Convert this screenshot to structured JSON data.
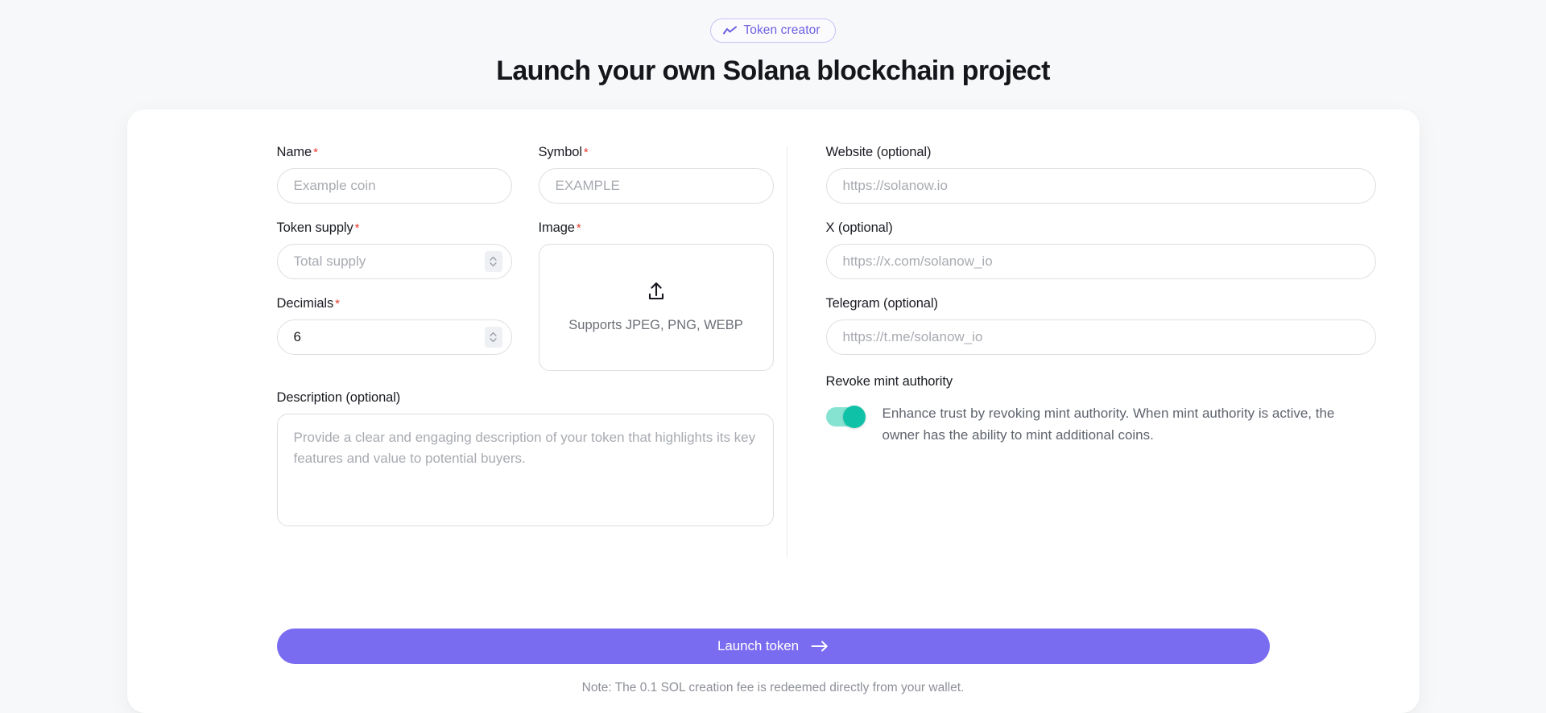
{
  "header": {
    "badge_label": "Token creator",
    "badge_icon": "trending-line-icon",
    "badge_color": "#6c5fe0",
    "headline": "Launch your own Solana blockchain project"
  },
  "form": {
    "name": {
      "label": "Name",
      "required_mark": "*",
      "placeholder": "Example coin",
      "value": ""
    },
    "symbol": {
      "label": "Symbol",
      "required_mark": "*",
      "placeholder": "EXAMPLE",
      "value": ""
    },
    "token_supply": {
      "label": "Token supply",
      "required_mark": "*",
      "placeholder": "Total supply",
      "value": ""
    },
    "image": {
      "label": "Image",
      "required_mark": "*",
      "upload_icon": "upload-icon",
      "support_text": "Supports JPEG, PNG, WEBP"
    },
    "decimals": {
      "label": "Decimials",
      "required_mark": "*",
      "value": "6",
      "placeholder": ""
    },
    "description": {
      "label": "Description (optional)",
      "placeholder": "Provide a clear and engaging description of your token that highlights its key features and value to potential buyers.",
      "value": ""
    },
    "website": {
      "label": "Website (optional)",
      "placeholder": "https://solanow.io",
      "value": ""
    },
    "x": {
      "label": "X (optional)",
      "placeholder": "https://x.com/solanow_io",
      "value": ""
    },
    "telegram": {
      "label": "Telegram (optional)",
      "placeholder": "https://t.me/solanow_io",
      "value": ""
    },
    "revoke_mint": {
      "label": "Revoke mint authority",
      "description": "Enhance trust by revoking mint authority. When mint authority is active, the owner has the ability to mint additional coins.",
      "toggle_state": "on",
      "toggle_on_color": "#0fc2a7",
      "toggle_track_color": "#86e3d2"
    }
  },
  "footer": {
    "submit_label": "Launch token",
    "submit_icon": "arrow-right-icon",
    "submit_color": "#7a6cf0",
    "note": "Note: The 0.1 SOL creation fee is redeemed directly from your wallet."
  }
}
